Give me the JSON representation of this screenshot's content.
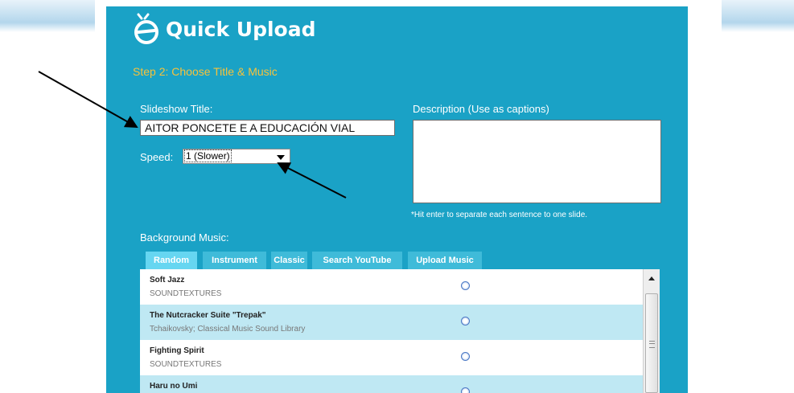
{
  "app": {
    "title": "Quick Upload",
    "step": "Step 2: Choose Title & Music"
  },
  "form": {
    "title_label": "Slideshow Title:",
    "title_value": "AITOR PONCETE E A EDUCACIÓN VIAL",
    "speed_label": "Speed:",
    "speed_value": "1 (Slower)",
    "description_label": "Description (Use as captions)",
    "description_value": "",
    "description_hint": "*Hit enter to separate each sentence to one slide."
  },
  "music": {
    "label": "Background Music:",
    "tabs": [
      {
        "label": "Random",
        "active": true
      },
      {
        "label": "Instrument",
        "active": false
      },
      {
        "label": "Classic",
        "active": false
      },
      {
        "label": "Search YouTube",
        "active": false
      },
      {
        "label": "Upload Music",
        "active": false
      }
    ],
    "tracks": [
      {
        "name": "Soft Jazz",
        "artist": "SOUNDTEXTURES"
      },
      {
        "name": "The Nutcracker Suite \"Trepak\"",
        "artist": "Tchaikovsky; Classical Music Sound Library"
      },
      {
        "name": "Fighting Spirit",
        "artist": "SOUNDTEXTURES"
      },
      {
        "name": "Haru no Umi",
        "artist": ""
      }
    ]
  },
  "colors": {
    "panel": "#1aa2c6",
    "step_text": "#f7c23b",
    "tab": "#3fbbd9",
    "tab_active": "#66d6f1",
    "row_alt": "#bfe8f3"
  },
  "icons": {
    "logo": "upload-logo-icon",
    "radio": "radio-button-icon",
    "scroll_up": "scroll-up-arrow-icon"
  }
}
